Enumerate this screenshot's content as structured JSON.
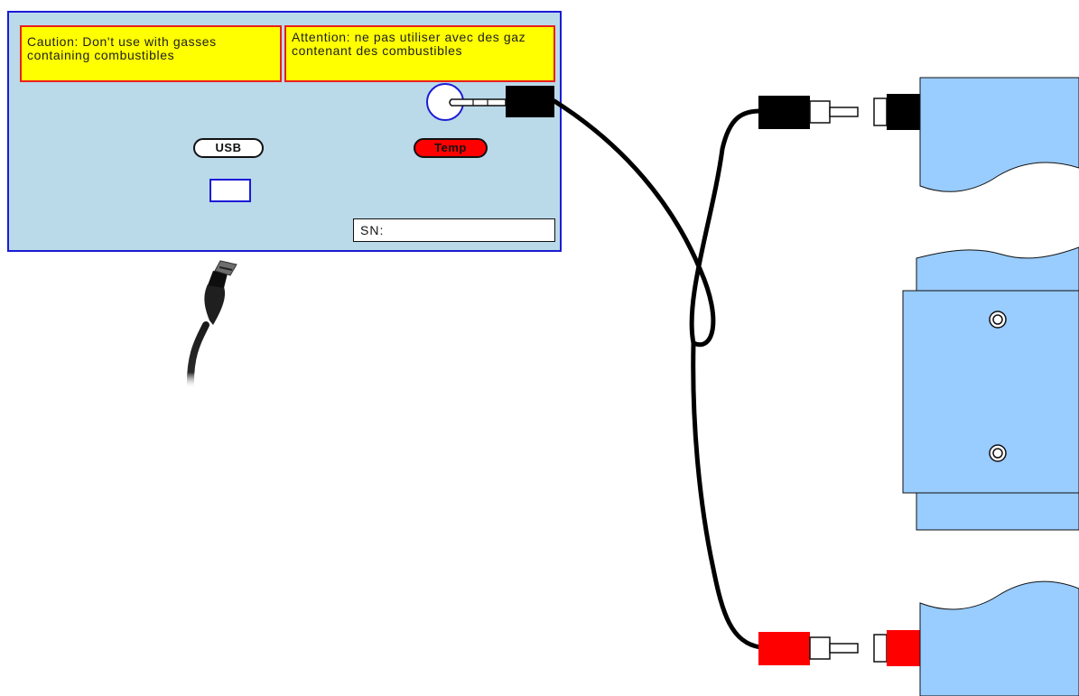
{
  "device": {
    "warning_en": "Caution: Don't use with gasses containing combustibles",
    "warning_fr": "Attention: ne pas utiliser avec des gaz contenant des combustibles",
    "usb_label": "USB",
    "temp_label": "Temp",
    "sn_label": "SN:"
  },
  "colors": {
    "panel_fill": "#bad9e9",
    "panel_border": "#1b1bd6",
    "warning_fill": "#ffff00",
    "warning_border": "#e8211b",
    "temp_pill": "#ff0000",
    "plate_fill": "#99ccff",
    "black_plug": "#000000",
    "red_plug": "#ff0000"
  },
  "icons": [
    "usb-cable-icon",
    "rca-plug-black-icon",
    "rca-plug-red-icon",
    "mini-jack-plug-icon",
    "screw-icon"
  ]
}
